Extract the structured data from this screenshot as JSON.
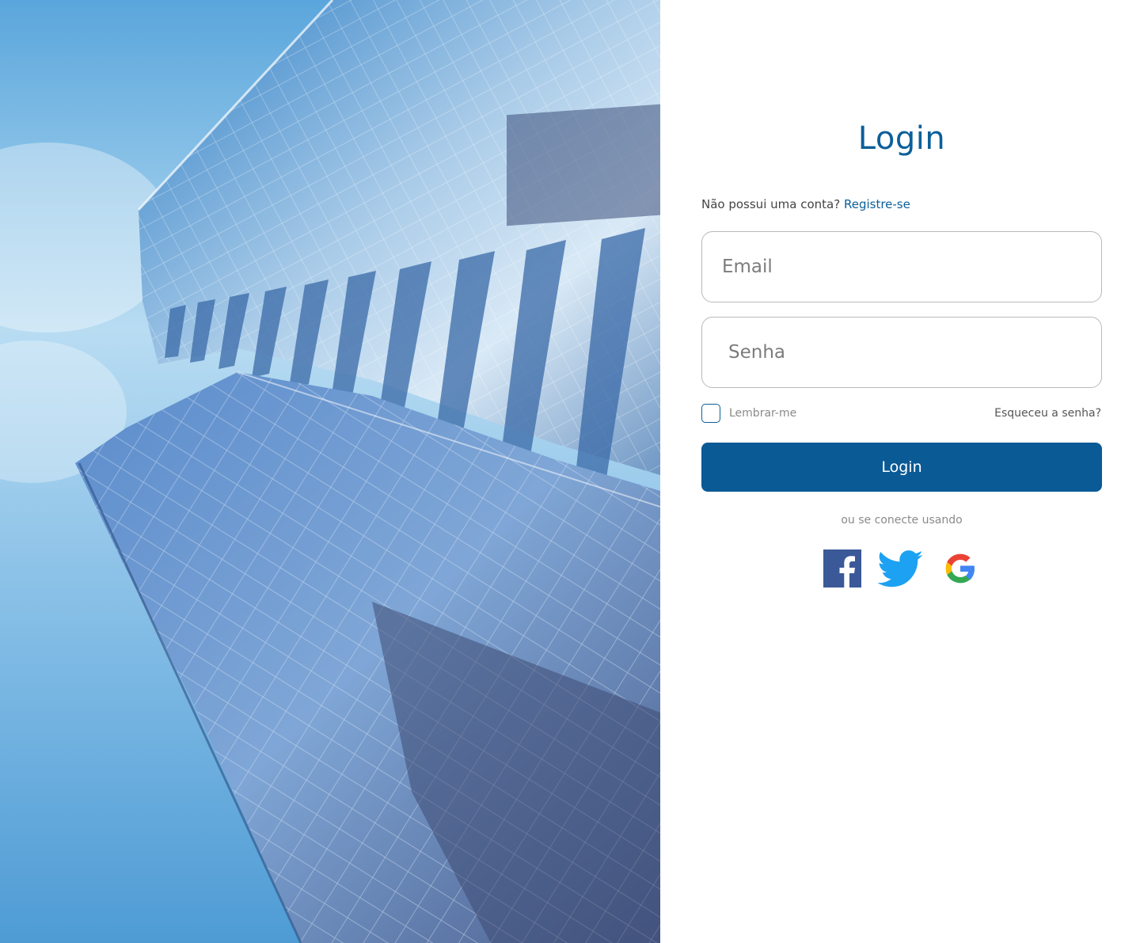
{
  "hero": {
    "image": "building-facade"
  },
  "login": {
    "title": "Login",
    "signup_prompt": "Não possui uma conta?",
    "signup_link": "Registre-se",
    "email_placeholder": "Email",
    "password_placeholder": "Senha",
    "remember_label": "Lembrar-me",
    "forgot_link": "Esqueceu a senha?",
    "submit_label": "Login",
    "social_prompt": "ou se conecte usando"
  },
  "social": {
    "facebook": "facebook-icon",
    "twitter": "twitter-icon",
    "google": "google-icon"
  },
  "colors": {
    "primary": "#0a5a96",
    "title": "#0c5f9a",
    "facebook": "#3b5998",
    "twitter": "#1da1f2"
  }
}
